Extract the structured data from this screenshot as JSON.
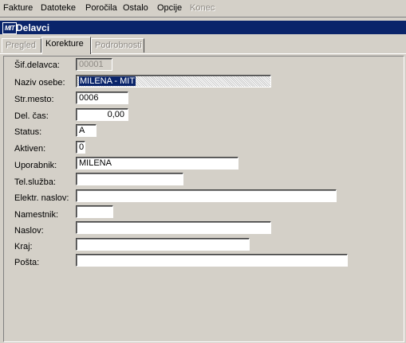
{
  "menu": {
    "items": [
      {
        "label": "Fakture",
        "enabled": true
      },
      {
        "label": "Datoteke",
        "enabled": true
      },
      {
        "label": "Poročila",
        "enabled": true
      },
      {
        "label": "Ostalo",
        "enabled": true
      },
      {
        "label": "Opcije",
        "enabled": true
      },
      {
        "label": "Konec",
        "enabled": false
      }
    ]
  },
  "window": {
    "logo_text": "MIT",
    "title": "Delavci"
  },
  "tabs": [
    {
      "label": "Pregled",
      "state": "disabled"
    },
    {
      "label": "Korekture",
      "state": "active"
    },
    {
      "label": "Podrobnosti",
      "state": "disabled"
    }
  ],
  "form": {
    "fields": [
      {
        "label": "Šif.delavca:",
        "value": "00001"
      },
      {
        "label": "Naziv osebe:",
        "value": "MILENA - MIT"
      },
      {
        "label": "Str.mesto:",
        "value": "0006"
      },
      {
        "label": "Del. čas:",
        "value": "0,00"
      },
      {
        "label": "Status:",
        "value": "A"
      },
      {
        "label": "Aktiven:",
        "value": "0"
      },
      {
        "label": "Uporabnik:",
        "value": "MILENA"
      },
      {
        "label": "Tel.služba:",
        "value": ""
      },
      {
        "label": "Elektr. naslov:",
        "value": ""
      },
      {
        "label": "Namestnik:",
        "value": ""
      },
      {
        "label": "Naslov:",
        "value": ""
      },
      {
        "label": "Kraj:",
        "value": ""
      },
      {
        "label": "Pošta:",
        "value": ""
      }
    ]
  },
  "colors": {
    "titlebar": "#0a246a",
    "face": "#d4d0c8",
    "field": "#ffffff",
    "disabled_text": "#8e8a84"
  }
}
